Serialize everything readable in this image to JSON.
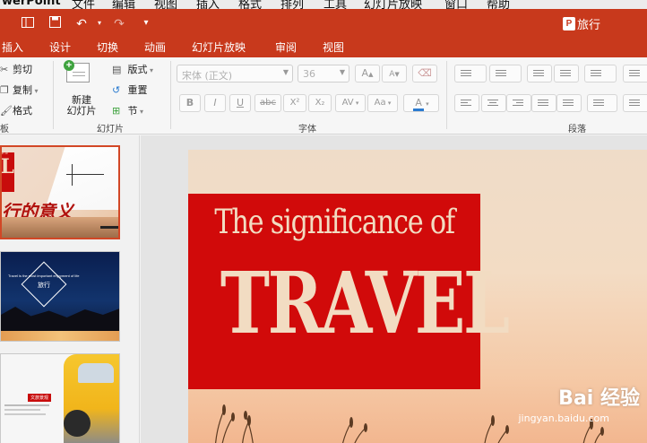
{
  "menubar": {
    "app_name": "werPoint",
    "items": [
      "文件",
      "编辑",
      "视图",
      "插入",
      "格式",
      "排列",
      "工具",
      "幻灯片放映",
      "窗口",
      "帮助"
    ]
  },
  "titlebar": {
    "title": "旅行",
    "doc_icon": "P",
    "undo": "↶",
    "redo": "↷"
  },
  "tabs": [
    "插入",
    "设计",
    "切换",
    "动画",
    "幻灯片放映",
    "审阅",
    "视图"
  ],
  "clipboard": {
    "cut": "剪切",
    "copy": "复制",
    "format": "格式",
    "group_tail": "板"
  },
  "slides_group": {
    "new_slide_line1": "新建",
    "new_slide_line2": "幻灯片",
    "layout": "版式",
    "reset": "重置",
    "section": "节",
    "label": "幻灯片"
  },
  "font_group": {
    "font_name": "宋体 (正文)",
    "font_size": "36",
    "grow": "A",
    "shrink": "A",
    "bold": "B",
    "italic": "I",
    "underline": "U",
    "strike": "abc",
    "superscript": "X²",
    "subscript": "X₂",
    "spacing": "AV",
    "case": "Aa",
    "color": "A",
    "label": "字体"
  },
  "paragraph_group": {
    "label": "段落"
  },
  "thumb1": {
    "title": "行的意义",
    "corner": "e of",
    "letter": "L"
  },
  "thumb2": {
    "tagline": "Travel is the most important enjoyment of life",
    "center": "旅行"
  },
  "thumb3": {
    "badge": "文旅景观"
  },
  "slide": {
    "line1": "The significance of",
    "line2": "TRAVEL"
  },
  "watermark": {
    "brand": "Bai 经验",
    "url": "jingyan.baidu.com"
  },
  "colors": {
    "accent": "#c8391c",
    "slide_red": "#d10a0a",
    "slide_text": "#f2dcc2"
  }
}
